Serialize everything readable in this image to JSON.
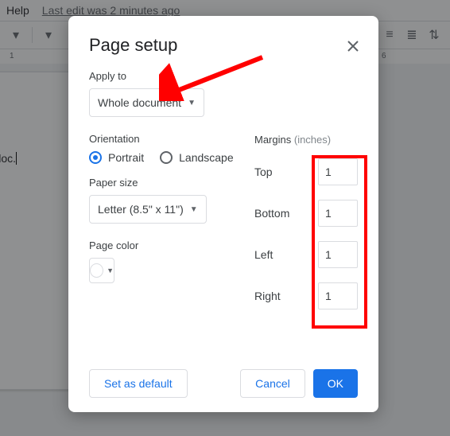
{
  "menubar": {
    "help": "Help",
    "edit_status": "Last edit was 2 minutes ago"
  },
  "ruler": {
    "t1": "1",
    "t6": "6"
  },
  "document": {
    "text": "ple doc."
  },
  "dialog": {
    "title": "Page setup",
    "apply_to": {
      "label": "Apply to",
      "value": "Whole document"
    },
    "orientation": {
      "label": "Orientation",
      "portrait": "Portrait",
      "landscape": "Landscape",
      "selected": "portrait"
    },
    "paper_size": {
      "label": "Paper size",
      "value": "Letter (8.5\" x 11\")"
    },
    "page_color": {
      "label": "Page color",
      "value": "#ffffff"
    },
    "margins": {
      "label": "Margins ",
      "unit": "(inches)",
      "top_label": "Top",
      "top": "1",
      "bottom_label": "Bottom",
      "bottom": "1",
      "left_label": "Left",
      "left": "1",
      "right_label": "Right",
      "right": "1"
    },
    "buttons": {
      "set_default": "Set as default",
      "cancel": "Cancel",
      "ok": "OK"
    }
  }
}
